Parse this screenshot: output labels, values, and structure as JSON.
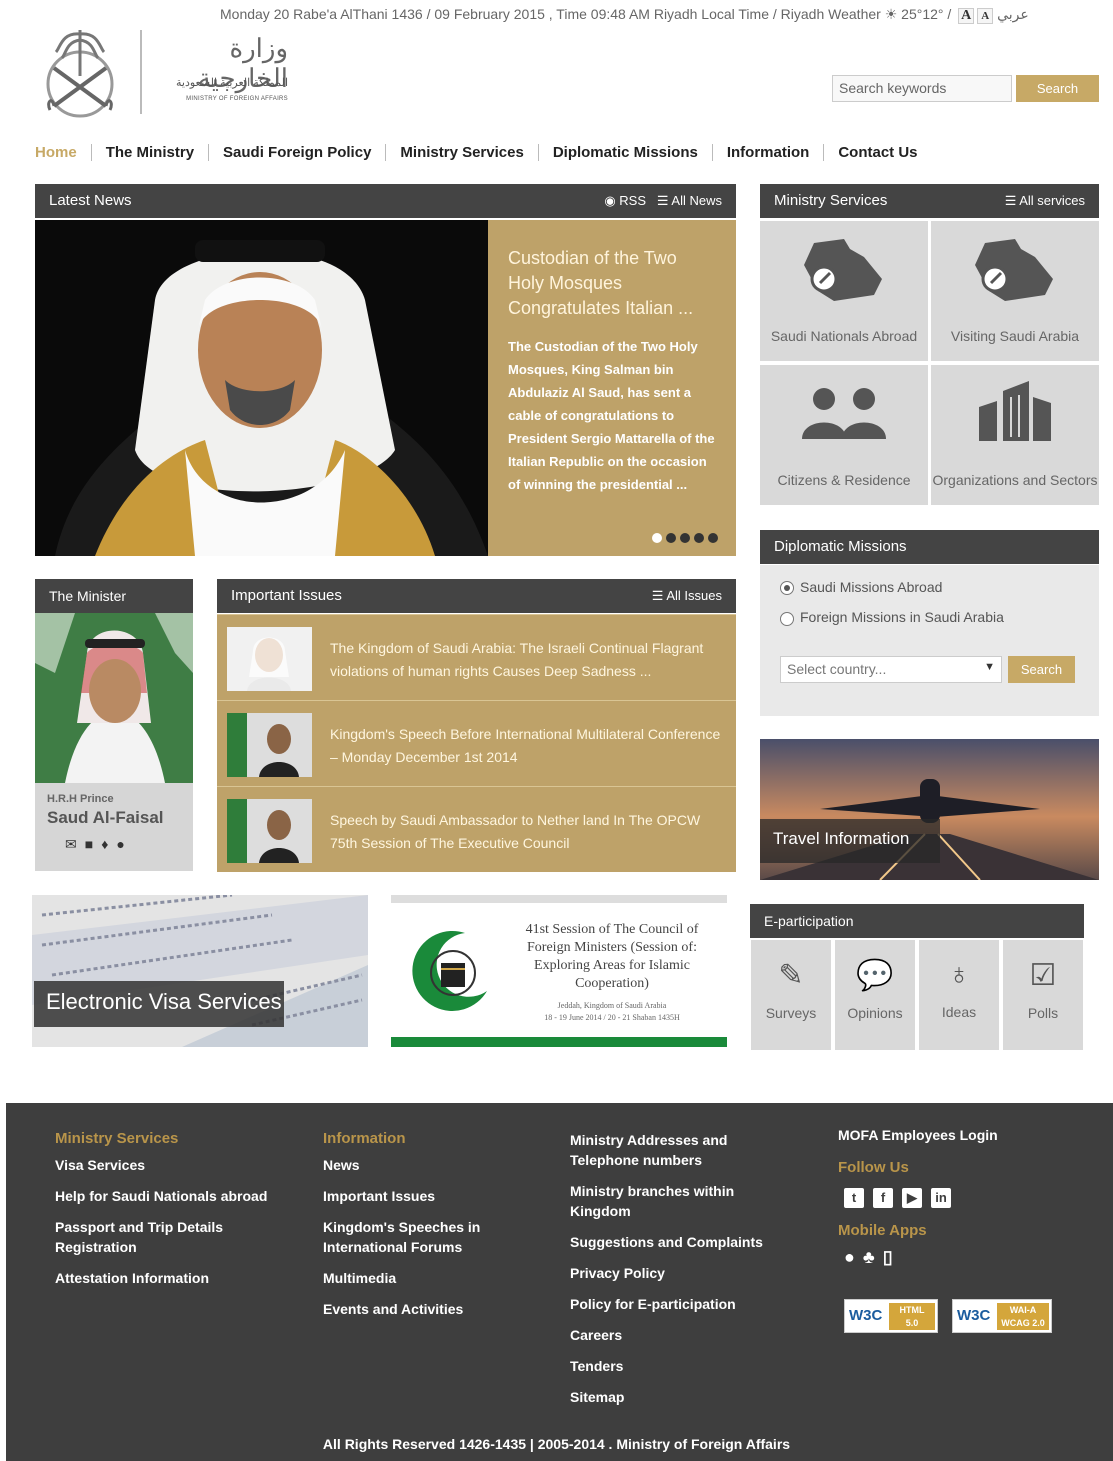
{
  "topbar": {
    "date_time": "Monday 20 Rabe'a AlThani 1436 / 09 February 2015 , Time 09:48 AM Riyadh Local Time",
    "weather_sep": "/",
    "weather": "Riyadh Weather",
    "temp": "25°12°",
    "sep2": "/",
    "lang": "عربي"
  },
  "logo": {
    "arabic_title": "وزارة الخارجية",
    "arabic_sub": "المملكة العربية السعودية",
    "english_sub": "MINISTRY OF FOREIGN AFFAIRS"
  },
  "search": {
    "placeholder": "Search keywords",
    "button": "Search"
  },
  "nav": [
    "Home",
    "The Ministry",
    "Saudi Foreign Policy",
    "Ministry Services",
    "Diplomatic Missions",
    "Information",
    "Contact Us"
  ],
  "latest_news": {
    "title": "Latest News",
    "rss": "RSS",
    "all": "All News",
    "headline": "Custodian of the Two Holy Mosques Congratulates Italian ...",
    "body": "The Custodian of the Two Holy Mosques, King Salman bin Abdulaziz Al Saud, has sent a cable of congratulations to President Sergio Mattarella of the Italian Republic on the occasion of winning the presidential ..."
  },
  "ministry_services": {
    "title": "Ministry Services",
    "all": "All services",
    "items": [
      "Saudi Nationals Abroad",
      "Visiting Saudi Arabia",
      "Citizens & Residence",
      "Organizations and Sectors"
    ]
  },
  "minister": {
    "title": "The Minister",
    "prefix": "H.R.H Prince",
    "name": "Saud Al-Faisal"
  },
  "issues": {
    "title": "Important Issues",
    "all": "All Issues",
    "items": [
      "The Kingdom of Saudi Arabia: The Israeli Continual Flagrant violations of human rights Causes Deep Sadness ...",
      "Kingdom's Speech Before International Multilateral Conference – Monday December 1st 2014",
      "Speech by Saudi Ambassador to Nether land In The OPCW 75th Session of The Executive Council"
    ]
  },
  "diplomatic": {
    "title": "Diplomatic Missions",
    "opt1": "Saudi Missions Abroad",
    "opt2": "Foreign Missions in Saudi Arabia",
    "select": "Select country...",
    "button": "Search"
  },
  "travel": {
    "label": "Travel Information"
  },
  "visa": {
    "label": "Electronic Visa Services"
  },
  "council": {
    "line": "41st Session of The Council of Foreign Ministers (Session of: Exploring Areas for Islamic Cooperation)",
    "place": "Jeddah, Kingdom of Saudi Arabia",
    "dates": "18 - 19 June 2014 / 20 - 21 Shaban 1435H"
  },
  "eparticipation": {
    "title": "E-participation",
    "items": [
      "Surveys",
      "Opinions",
      "Ideas",
      "Polls"
    ]
  },
  "footer": {
    "col1": {
      "head": "Ministry Services",
      "links": [
        "Visa Services",
        "Help for Saudi Nationals abroad",
        "Passport and Trip Details Registration",
        "Attestation Information"
      ]
    },
    "col2": {
      "head": "Information",
      "links": [
        "News",
        "Important Issues",
        "Kingdom's Speeches in International Forums",
        "Multimedia",
        "Events and Activities"
      ]
    },
    "col3": {
      "links": [
        "Ministry Addresses and Telephone numbers",
        "Ministry branches within Kingdom",
        "Suggestions and Complaints",
        "Privacy Policy",
        "Policy for E-participation",
        "Careers",
        "Tenders",
        "Sitemap"
      ]
    },
    "col4": {
      "login": "MOFA Employees Login",
      "follow": "Follow Us",
      "apps": "Mobile Apps",
      "badge1_top": "HTML",
      "badge1_bot": "5.0",
      "badge2_top": "WAI-A",
      "badge2_bot": "WCAG 2.0",
      "w3c": "W3C"
    },
    "copyright": "All Rights Reserved 1426-1435 | 2005-2014 . Ministry of Foreign Affairs"
  },
  "colors": {
    "gold": "#bea269",
    "dark": "#444444",
    "footer": "#3e3e3e"
  }
}
